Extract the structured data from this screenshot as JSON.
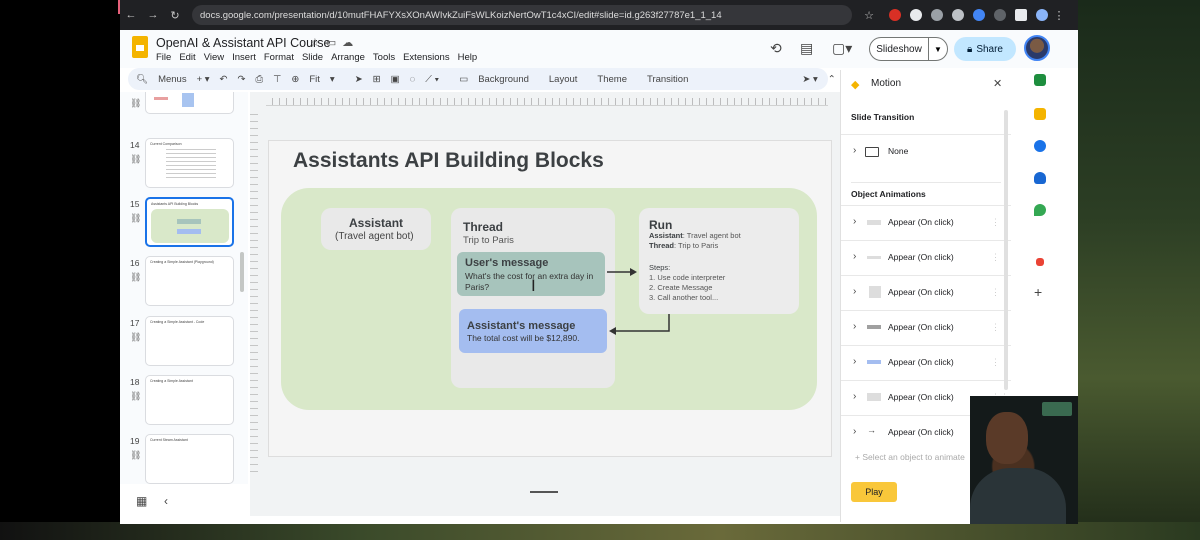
{
  "browser": {
    "url": "docs.google.com/presentation/d/10mutFHAFYXsXOnAWIvkZuiFsWLKoizNertOwT1c4xCI/edit#slide=id.g263f27787e1_1_14"
  },
  "app": {
    "title": "OpenAI & Assistant API Course",
    "menu": [
      "File",
      "Edit",
      "View",
      "Insert",
      "Format",
      "Slide",
      "Arrange",
      "Tools",
      "Extensions",
      "Help"
    ],
    "slideshow_label": "Slideshow",
    "share_label": "Share",
    "share_icon": "lock-icon"
  },
  "toolbar": {
    "menus_label": "Menus",
    "zoom": "Fit",
    "background": "Background",
    "layout": "Layout",
    "theme": "Theme",
    "transition": "Transition"
  },
  "filmstrip": {
    "slides": [
      {
        "num": "",
        "title": ""
      },
      {
        "num": "14",
        "title": "Current Comparison"
      },
      {
        "num": "15",
        "title": "Assistants API Building Blocks"
      },
      {
        "num": "16",
        "title": "Creating a Simple Assistant (Playground)"
      },
      {
        "num": "17",
        "title": "Creating a Simple Assistant - Code"
      },
      {
        "num": "18",
        "title": "Creating a Simple Assistant"
      },
      {
        "num": "19",
        "title": "Current Steam Assistant"
      }
    ]
  },
  "slide": {
    "title": "Assistants API Building Blocks",
    "assistant": {
      "title": "Assistant",
      "subtitle": "(Travel agent bot)"
    },
    "thread": {
      "title": "Thread",
      "subtitle": "Trip to Paris"
    },
    "user_message": {
      "title": "User's message",
      "body": "What's the cost for an extra day in Paris?"
    },
    "assistant_message": {
      "title": "Assistant's message",
      "body": "The total cost will be $12,890."
    },
    "run": {
      "title": "Run",
      "assistant_label": "Assistant",
      "assistant_value": ": Travel agent bot",
      "thread_label": "Thread",
      "thread_value": ": Trip to Paris",
      "steps_label": "Steps:",
      "steps": [
        "1.     Use code interpreter",
        "2.     Create Message",
        "3.     Call another tool..."
      ]
    }
  },
  "motion": {
    "title": "Motion",
    "slide_transition_label": "Slide Transition",
    "transition_value": "None",
    "object_animations_label": "Object Animations",
    "animations": [
      "Appear  (On click)",
      "Appear  (On click)",
      "Appear  (On click)",
      "Appear  (On click)",
      "Appear  (On click)",
      "Appear  (On click)",
      "Appear  (On click)"
    ],
    "select_hint": "+ Select an object to animate",
    "play_label": "Play"
  },
  "colors": {
    "accent": "#1a73e8",
    "slides_yellow": "#f4b400",
    "user_msg": "#a7c4bc",
    "assistant_msg": "#a4bdf0",
    "blob_green": "#d9e8c9",
    "play": "#f9c73a"
  }
}
